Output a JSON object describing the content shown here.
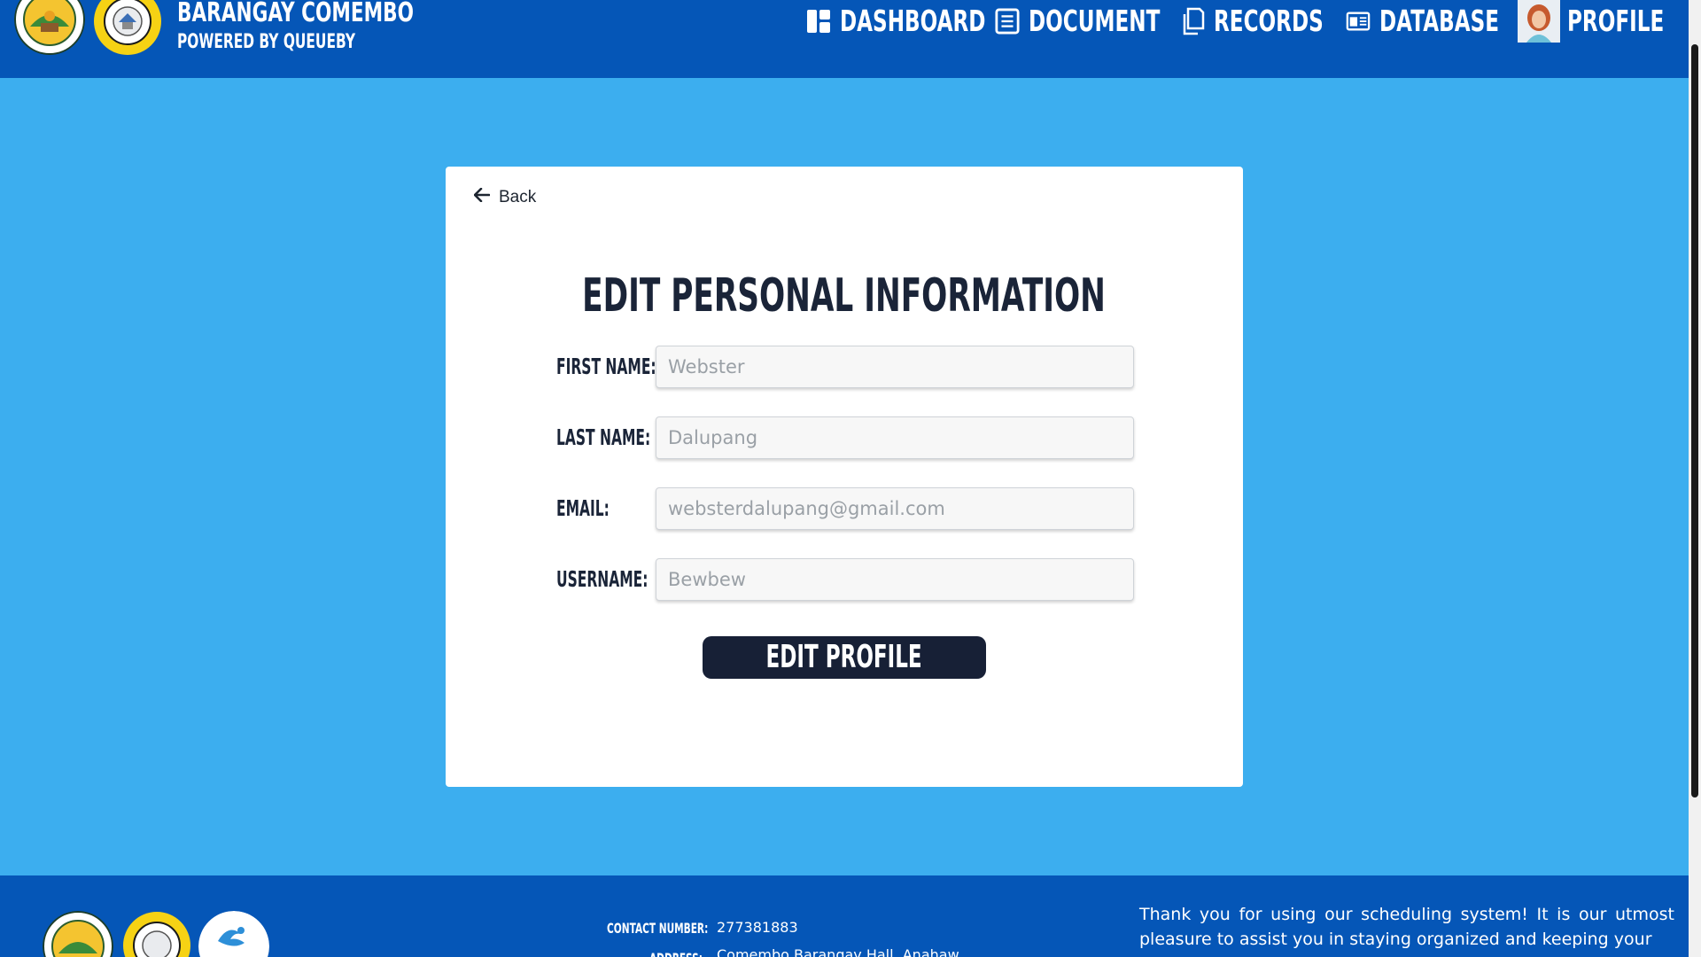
{
  "header": {
    "brand_title": "BARANGAY COMEMBO",
    "brand_sub": "POWERED BY QUEUEBY",
    "nav": {
      "dashboard": "DASHBOARD",
      "document": "DOCUMENT",
      "records": "RECORDS",
      "database": "DATABASE",
      "profile": "PROFILE"
    }
  },
  "card": {
    "back_label": "Back",
    "title": "EDIT PERSONAL INFORMATION",
    "fields": {
      "first_name": {
        "label": "FIRST NAME:",
        "placeholder": "Webster"
      },
      "last_name": {
        "label": "LAST NAME:",
        "placeholder": "Dalupang"
      },
      "email": {
        "label": "EMAIL:",
        "placeholder": "websterdalupang@gmail.com"
      },
      "username": {
        "label": "USERNAME:",
        "placeholder": "Bewbew"
      }
    },
    "submit_label": "EDIT PROFILE"
  },
  "footer": {
    "contact_label": "CONTACT NUMBER:",
    "contact_value": "277381883",
    "address_label": "ADDRESS:",
    "address_value": "Comembo Barangay Hall, Anahaw",
    "thanks": "Thank you for using our scheduling system! It is our utmost pleasure to assist you in staying organized and keeping your"
  },
  "colors": {
    "header_bg": "#0556b7",
    "page_bg": "#3caeef",
    "button_bg": "#172036",
    "title_text": "#1a2438"
  }
}
